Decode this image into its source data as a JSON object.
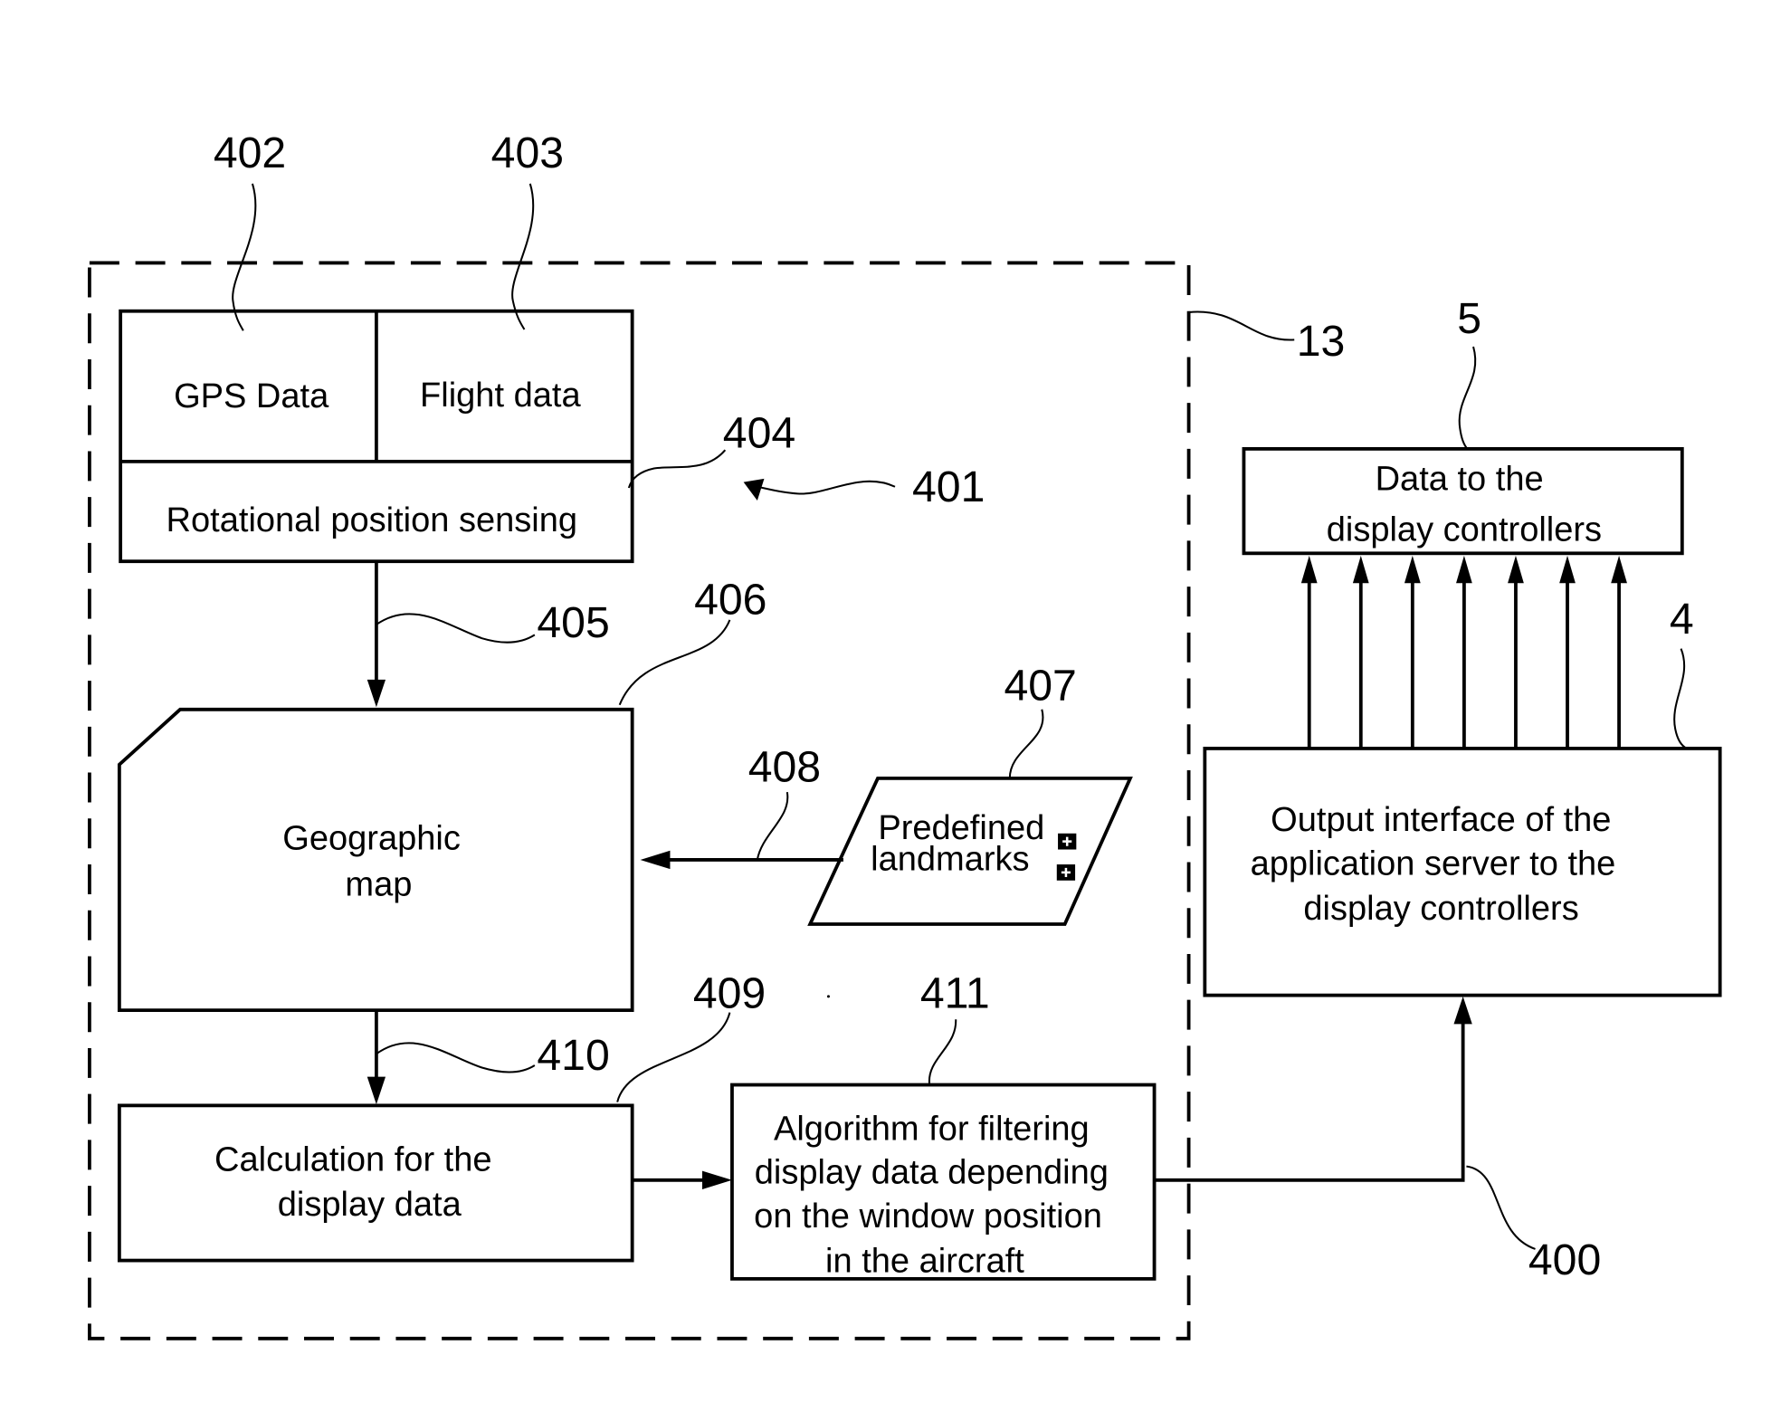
{
  "diagram": {
    "container": {
      "ref": "13"
    },
    "system_ref": "401",
    "blocks": {
      "gps": {
        "label": "GPS Data",
        "ref": "402"
      },
      "flight": {
        "label": "Flight data",
        "ref": "403"
      },
      "rotational": {
        "label": "Rotational position sensing",
        "ref": "404"
      },
      "map": {
        "label_lines": [
          "Geographic",
          "map"
        ],
        "ref": "406"
      },
      "landmarks": {
        "label_lines": [
          "Predefined",
          "landmarks"
        ],
        "ref": "407"
      },
      "calculation": {
        "label_lines": [
          "Calculation for the",
          "display data"
        ],
        "ref": "409"
      },
      "algorithm": {
        "label_lines": [
          "Algorithm for filtering",
          "display data depending",
          "on the window position",
          "in the aircraft"
        ],
        "ref": "411"
      },
      "output_interface": {
        "label_lines": [
          "Output interface of the",
          "application server to the",
          "display controllers"
        ],
        "ref": "4"
      },
      "data_to_controllers": {
        "label_lines": [
          "Data to the",
          "display controllers"
        ],
        "ref": "5"
      }
    },
    "connections": {
      "rotational_to_map": {
        "ref": "405"
      },
      "landmarks_to_map": {
        "ref": "408"
      },
      "map_to_calculation": {
        "ref": "410"
      },
      "algorithm_to_output": {
        "ref": "400"
      },
      "output_to_data_count": 7
    }
  }
}
